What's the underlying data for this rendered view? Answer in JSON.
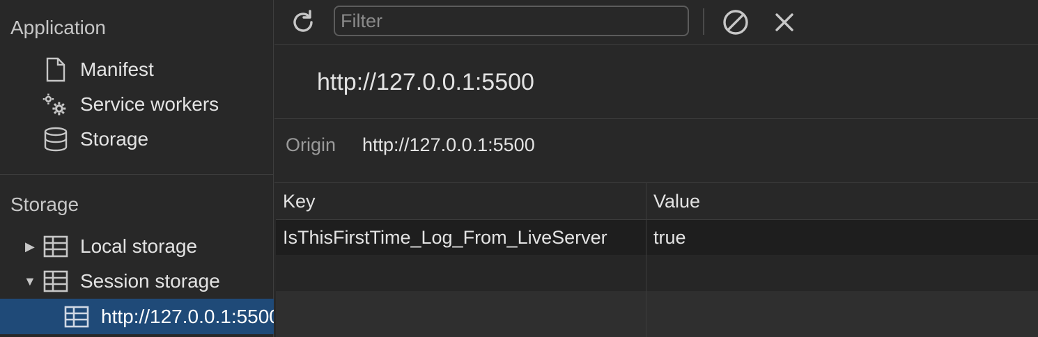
{
  "sidebar": {
    "application_title": "Application",
    "application_items": [
      {
        "label": "Manifest",
        "icon": "document-icon"
      },
      {
        "label": "Service workers",
        "icon": "gears-icon"
      },
      {
        "label": "Storage",
        "icon": "database-icon"
      }
    ],
    "storage_title": "Storage",
    "storage_items": [
      {
        "label": "Local storage",
        "icon": "table-icon",
        "expanded": false
      },
      {
        "label": "Session storage",
        "icon": "table-icon",
        "expanded": true
      }
    ],
    "selected_child": {
      "label": "http://127.0.0.1:5500",
      "icon": "table-icon"
    }
  },
  "toolbar": {
    "refresh_icon": "refresh-icon",
    "filter_placeholder": "Filter",
    "clear_icon": "clear-all-icon",
    "delete_icon": "close-icon"
  },
  "storage_view": {
    "title": "http://127.0.0.1:5500",
    "origin_label": "Origin",
    "origin_value": "http://127.0.0.1:5500"
  },
  "table": {
    "columns": [
      "Key",
      "Value"
    ],
    "rows": [
      {
        "key": "IsThisFirstTime_Log_From_LiveServer",
        "value": "true"
      }
    ]
  },
  "colors": {
    "background": "#282828",
    "selected": "#1f4a78",
    "border": "#3d3d3d"
  }
}
